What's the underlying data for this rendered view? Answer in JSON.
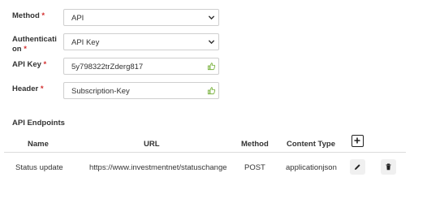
{
  "form": {
    "method": {
      "label": "Method",
      "value": "API"
    },
    "authentication": {
      "label_line1": "Authenticati",
      "label_line2": "on",
      "value": "API Key"
    },
    "api_key": {
      "label": "API Key",
      "value": "5y798322trZderg817"
    },
    "header": {
      "label": "Header",
      "value": "Subscription-Key"
    },
    "required_marker": "*"
  },
  "endpoints": {
    "title": "API Endpoints",
    "columns": [
      "Name",
      "URL",
      "Method",
      "Content Type"
    ],
    "rows": [
      {
        "name": "Status update",
        "url": "https://www.investmentnet/statuschange",
        "method": "POST",
        "content_type": "applicationjson"
      }
    ]
  },
  "icons": {
    "select": "chevron-down-icon",
    "valid": "thumbs-up-icon",
    "add": "plus-icon",
    "edit": "pencil-icon",
    "delete": "trash-icon"
  },
  "colors": {
    "required": "#d32f2f",
    "valid": "#7cb342",
    "border": "#cfcfcf",
    "action_bg": "#f0f0f0"
  }
}
